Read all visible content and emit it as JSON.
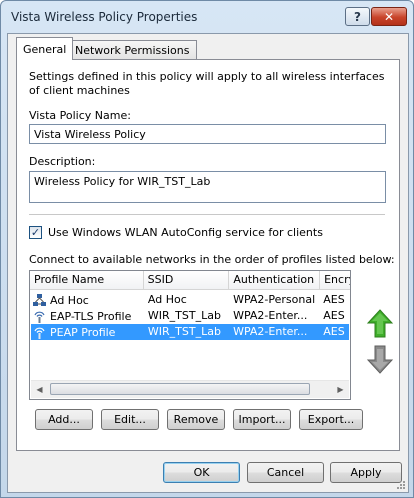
{
  "window": {
    "title": "Vista Wireless Policy Properties",
    "help_label": "?",
    "close_label": "✕"
  },
  "tabs": [
    {
      "label": "General",
      "active": true
    },
    {
      "label": "Network Permissions",
      "active": false
    }
  ],
  "general": {
    "intro": "Settings defined in this policy will apply to all wireless interfaces of client machines",
    "name_label": "Vista Policy Name:",
    "name_value": "Vista Wireless Policy",
    "desc_label": "Description:",
    "desc_value": "Wireless Policy for WIR_TST_Lab",
    "autoconfig_label": "Use Windows WLAN AutoConfig service for clients",
    "autoconfig_checked": true,
    "connect_label": "Connect to available networks in the order of profiles listed below:"
  },
  "profiles": {
    "columns": [
      "Profile Name",
      "SSID",
      "Authentication",
      "Encry"
    ],
    "rows": [
      {
        "name": "Ad Hoc",
        "ssid": "Ad Hoc",
        "auth": "WPA2-Personal",
        "enc": "AES",
        "icon": "adhoc-network-icon",
        "selected": false
      },
      {
        "name": "EAP-TLS Profile",
        "ssid": "WIR_TST_Lab",
        "auth": "WPA2-Enter...",
        "enc": "AES",
        "icon": "wireless-network-icon",
        "selected": false
      },
      {
        "name": "PEAP Profile",
        "ssid": "WIR_TST_Lab",
        "auth": "WPA2-Enter...",
        "enc": "AES",
        "icon": "wireless-network-icon",
        "selected": true
      }
    ]
  },
  "buttons": {
    "add": "Add...",
    "edit": "Edit...",
    "remove": "Remove",
    "import": "Import...",
    "export": "Export...",
    "ok": "OK",
    "cancel": "Cancel",
    "apply": "Apply"
  },
  "colors": {
    "selection": "#3399ff",
    "move_up_arrow": "#3fae2a",
    "move_down_arrow": "#8a8a8a"
  }
}
